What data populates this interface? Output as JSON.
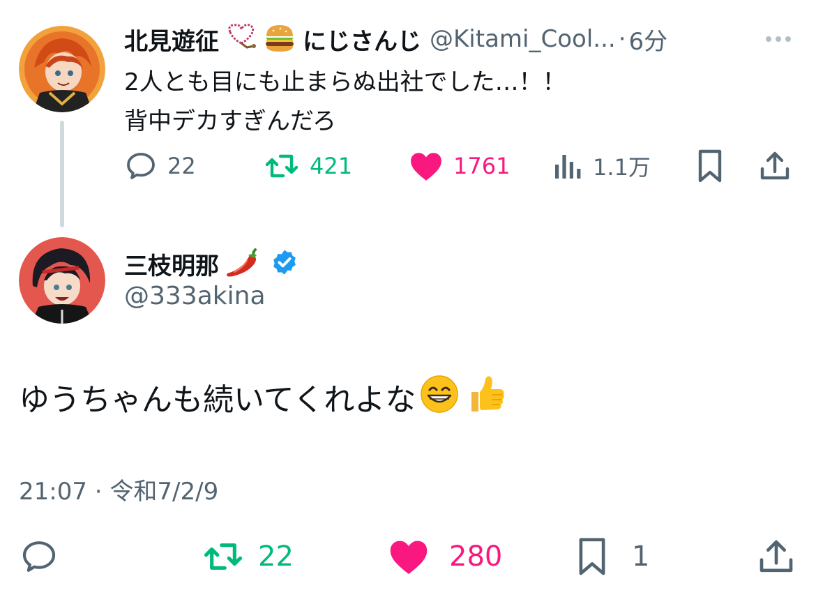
{
  "parent_tweet": {
    "display_name": "北見遊征",
    "name_suffix": "にじさんじ",
    "handle": "@Kitami_Cool...",
    "separator": "·",
    "time_ago": "6分",
    "text_line1": "2人とも目にも止まらぬ出社でした…！！",
    "text_line2": "背中デカすぎんだろ",
    "actions": {
      "reply_count": "22",
      "retweet_count": "421",
      "like_count": "1761",
      "view_count": "1.1万"
    },
    "icons": [
      "prayer-beads-emoji",
      "hamburger-emoji",
      "more-icon",
      "reply-icon",
      "retweet-icon",
      "like-icon",
      "views-icon",
      "bookmark-icon",
      "share-icon"
    ]
  },
  "reply_tweet": {
    "display_name": "三枝明那",
    "handle": "@333akina",
    "text": "ゆうちゃんも続いてくれよな",
    "timestamp": "21:07 · 令和7/2/9",
    "actions": {
      "retweet_count": "22",
      "like_count": "280",
      "bookmark_count": "1"
    },
    "icons": [
      "chili-pepper-emoji",
      "verified-badge-icon",
      "grinning-face-emoji",
      "thumbs-up-emoji"
    ]
  },
  "colors": {
    "text_primary": "#0f1419",
    "text_secondary": "#536471",
    "retweet_green": "#00ba7c",
    "like_pink": "#f91880",
    "verified_blue": "#1d9bf0",
    "thread_line": "#cfd9de"
  }
}
